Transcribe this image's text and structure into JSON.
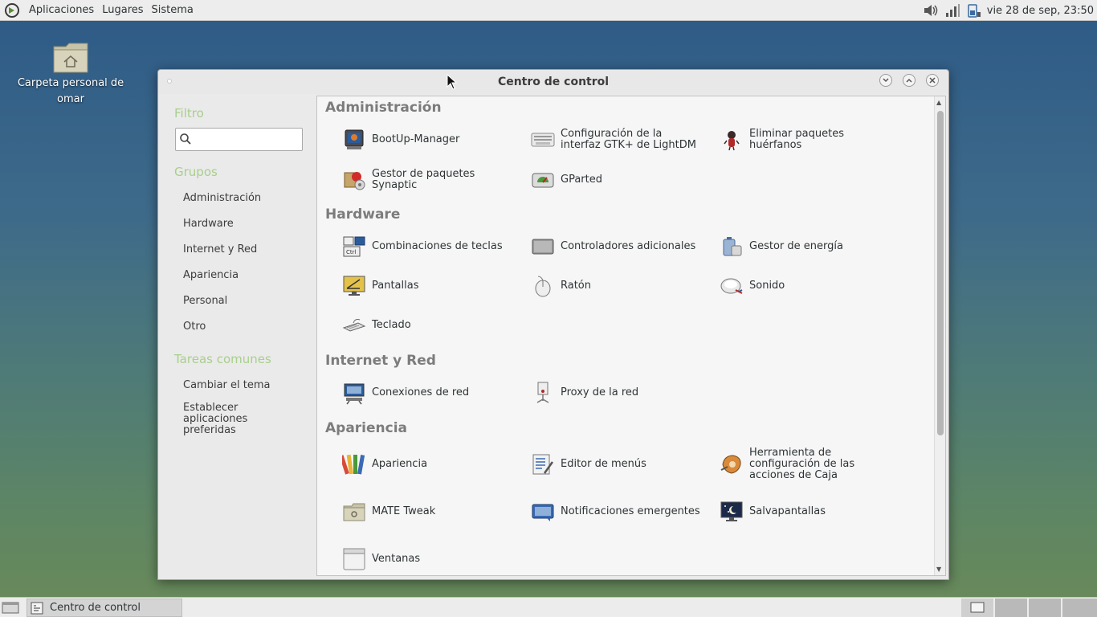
{
  "top_panel": {
    "menus": [
      "Aplicaciones",
      "Lugares",
      "Sistema"
    ],
    "clock": "vie 28 de sep, 23:50",
    "tray_icons": [
      "volume-icon",
      "network-signal-icon",
      "battery-icon"
    ]
  },
  "desktop": {
    "home_label": "Carpeta personal de omar"
  },
  "window": {
    "title": "Centro de control",
    "sidebar": {
      "filter_heading": "Filtro",
      "search_placeholder": "",
      "groups_heading": "Grupos",
      "groups": [
        "Administración",
        "Hardware",
        "Internet y Red",
        "Apariencia",
        "Personal",
        "Otro"
      ],
      "tasks_heading": "Tareas comunes",
      "tasks": [
        "Cambiar el tema",
        "Establecer aplicaciones preferidas"
      ]
    },
    "sections": [
      {
        "title": "Administración",
        "items": [
          {
            "label": "BootUp-Manager",
            "icon": "bootup-manager-icon"
          },
          {
            "label": "Configuración de la interfaz GTK+ de LightDM",
            "icon": "lightdm-config-icon"
          },
          {
            "label": "Eliminar paquetes huérfanos",
            "icon": "orphan-packages-icon"
          },
          {
            "label": "Gestor de paquetes Synaptic",
            "icon": "synaptic-icon"
          },
          {
            "label": "GParted",
            "icon": "gparted-icon"
          }
        ]
      },
      {
        "title": "Hardware",
        "items": [
          {
            "label": "Combinaciones de teclas",
            "icon": "keyboard-shortcuts-icon"
          },
          {
            "label": "Controladores adicionales",
            "icon": "drivers-icon"
          },
          {
            "label": "Gestor de energía",
            "icon": "power-manager-icon"
          },
          {
            "label": "Pantallas",
            "icon": "displays-icon"
          },
          {
            "label": "Ratón",
            "icon": "mouse-icon"
          },
          {
            "label": "Sonido",
            "icon": "sound-icon"
          },
          {
            "label": "Teclado",
            "icon": "keyboard-icon"
          }
        ]
      },
      {
        "title": "Internet y Red",
        "items": [
          {
            "label": "Conexiones de red",
            "icon": "network-connections-icon"
          },
          {
            "label": "Proxy de la red",
            "icon": "network-proxy-icon"
          }
        ]
      },
      {
        "title": "Apariencia",
        "items": [
          {
            "label": "Apariencia",
            "icon": "appearance-icon"
          },
          {
            "label": "Editor de menús",
            "icon": "menu-editor-icon"
          },
          {
            "label": "Herramienta de configuración de las acciones de Caja",
            "icon": "caja-actions-icon"
          },
          {
            "label": "MATE Tweak",
            "icon": "mate-tweak-icon"
          },
          {
            "label": "Notificaciones emergentes",
            "icon": "notifications-icon"
          },
          {
            "label": "Salvapantallas",
            "icon": "screensaver-icon"
          },
          {
            "label": "Ventanas",
            "icon": "windows-icon"
          }
        ]
      }
    ]
  },
  "taskbar": {
    "task_label": "Centro de control",
    "workspaces": 4
  }
}
